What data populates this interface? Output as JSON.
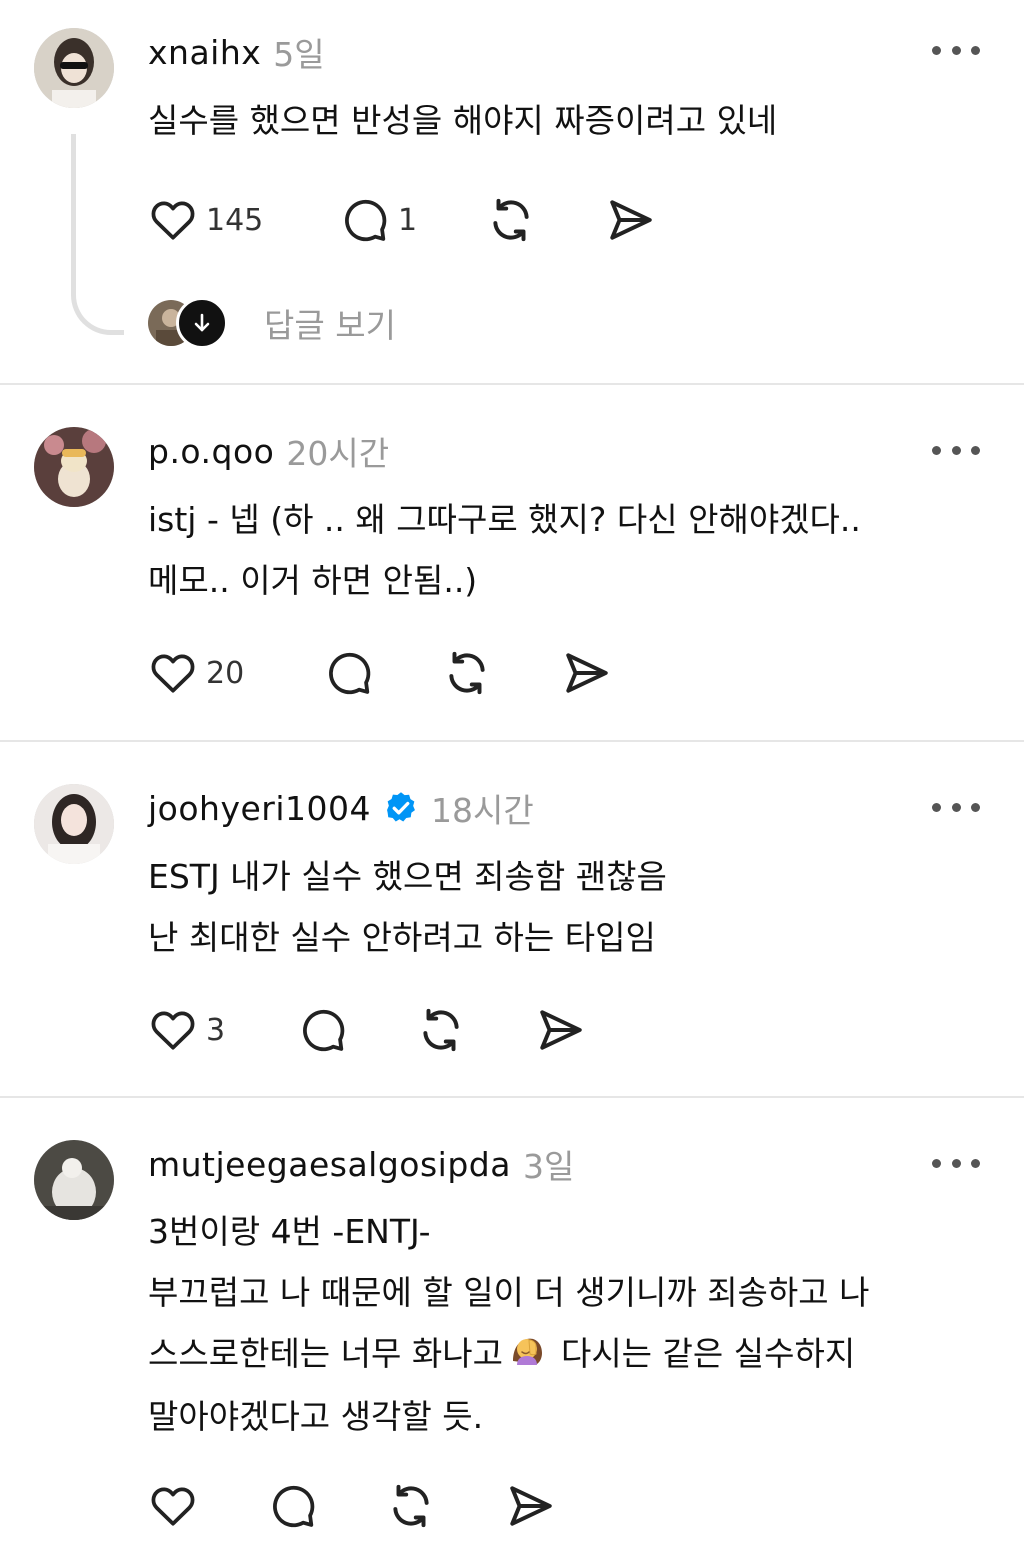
{
  "comments": [
    {
      "username": "xnaihx",
      "time": "5일",
      "verified": false,
      "lines": [
        "실수를 했으면 반성을 해야지 짜증이려고 있네"
      ],
      "likes": "145",
      "replies": "1",
      "view_replies_label": "답글 보기"
    },
    {
      "username": "p.o.qoo",
      "time": "20시간",
      "verified": false,
      "lines": [
        "istj - 넵 (하 .. 왜 그따구로 했지? 다신 안해야겠다..",
        "메모.. 이거 하면 안됨..)"
      ],
      "likes": "20",
      "replies": ""
    },
    {
      "username": "joohyeri1004",
      "time": "18시간",
      "verified": true,
      "lines": [
        "ESTJ 내가 실수 했으면 죄송함 괜찮음",
        "난 최대한 실수 안하려고 하는 타입임"
      ],
      "likes": "3",
      "replies": ""
    },
    {
      "username": "mutjeegaesalgosipda",
      "time": "3일",
      "verified": false,
      "lines": [
        "3번이랑 4번 -ENTJ-",
        "부끄럽고 나 때문에 할 일이 더 생기니까 죄송하고 나",
        "스스로한테는 너무 화나고",
        "다시는 같은 실수하지",
        "말아야겠다고 생각할 듯."
      ],
      "likes": "",
      "replies": ""
    }
  ],
  "icons": {
    "like": "heart-icon",
    "comment": "speech-bubble-icon",
    "repost": "repost-icon",
    "share": "send-icon",
    "more": "more-dots-icon",
    "verified": "verified-badge-icon",
    "expand": "arrow-down-icon",
    "emoji": "facepalm-emoji"
  },
  "colors": {
    "text": "#111111",
    "muted": "#9a9a9a",
    "verified": "#0095f6",
    "divider": "#e6e6e6"
  }
}
